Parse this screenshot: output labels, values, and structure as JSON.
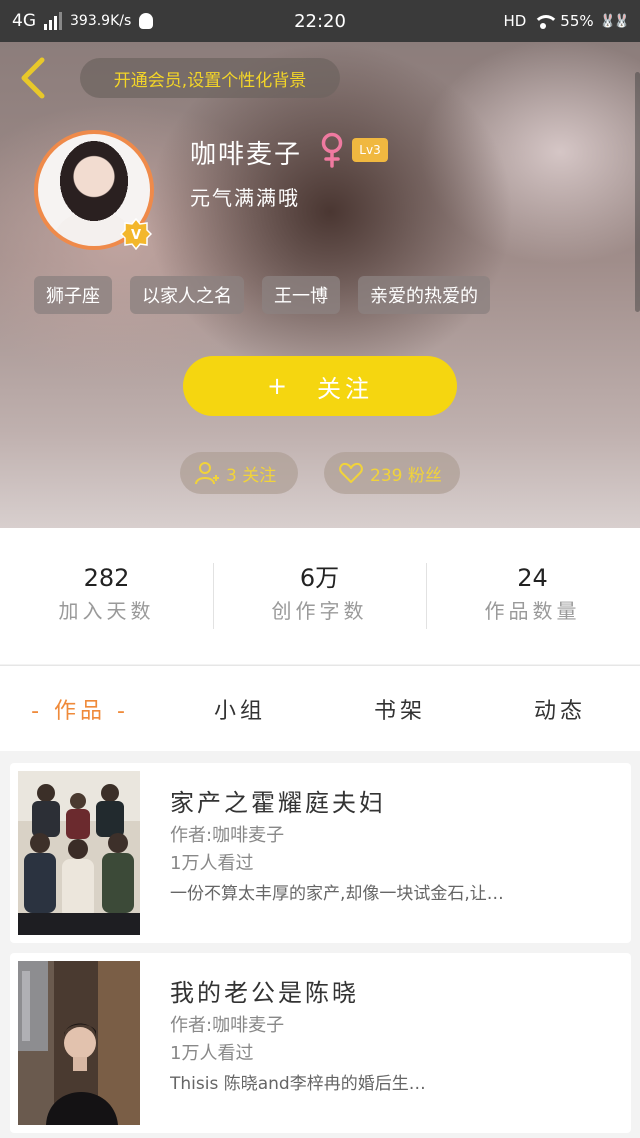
{
  "status_bar": {
    "network": "4G",
    "speed": "393.9K/s",
    "time": "22:20",
    "hd": "HD",
    "battery": "55%"
  },
  "header": {
    "vip_banner": "开通会员,设置个性化背景",
    "nickname": "咖啡麦子",
    "gender_icon": "female-icon",
    "level": "Lv3",
    "signature": "元气满满哦",
    "tags": [
      "狮子座",
      "以家人之名",
      "王一博",
      "亲爱的热爱的"
    ],
    "follow_button": {
      "plus": "+",
      "label": "关注"
    },
    "following": "3 关注",
    "fans": "239 粉丝"
  },
  "stats": [
    {
      "value": "282",
      "label": "加入天数"
    },
    {
      "value": "6万",
      "label": "创作字数"
    },
    {
      "value": "24",
      "label": "作品数量"
    }
  ],
  "tabs": [
    "- 作品 -",
    "小组",
    "书架",
    "动态"
  ],
  "works": [
    {
      "title": "家产之霍耀庭夫妇",
      "author": "作者:咖啡麦子",
      "views": "1万人看过",
      "desc": "一份不算太丰厚的家产,却像一块试金石,让…"
    },
    {
      "title": "我的老公是陈晓",
      "author": "作者:咖啡麦子",
      "views": "1万人看过",
      "desc": "Thisis 陈晓and李梓冉的婚后生…"
    }
  ],
  "colors": {
    "accent_yellow": "#f5d610",
    "accent_orange": "#ef8a3a",
    "banner_text": "#f3d528"
  }
}
